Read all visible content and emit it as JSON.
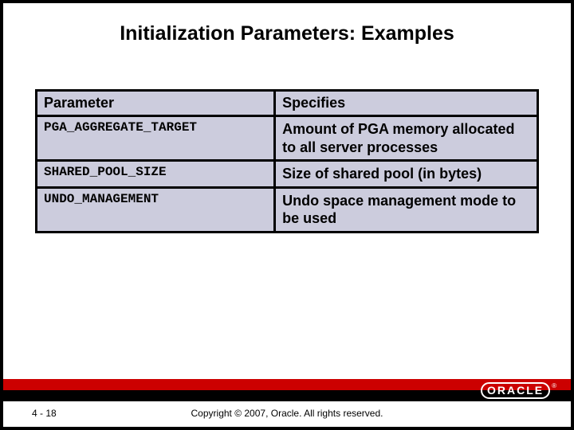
{
  "title": "Initialization Parameters: Examples",
  "table": {
    "headers": {
      "param": "Parameter",
      "spec": "Specifies"
    },
    "rows": [
      {
        "param": "PGA_AGGREGATE_TARGET",
        "spec": "Amount of PGA memory allocated to all server processes"
      },
      {
        "param": "SHARED_POOL_SIZE",
        "spec": "Size of shared pool (in bytes)"
      },
      {
        "param": "UNDO_MANAGEMENT",
        "spec": "Undo space management mode to be used"
      }
    ]
  },
  "footer": {
    "page": "4 - 18",
    "copyright": "Copyright © 2007, Oracle. All rights reserved.",
    "logo_text": "ORACLE",
    "logo_reg": "®"
  }
}
